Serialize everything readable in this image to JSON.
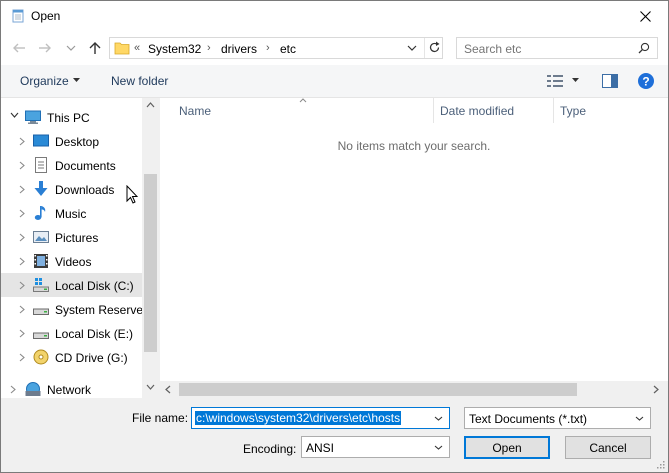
{
  "window": {
    "title": "Open",
    "icons": {
      "app": "notepad-icon",
      "close": "close-icon"
    }
  },
  "navigation": {
    "back": "back-arrow-icon",
    "forward": "forward-arrow-icon",
    "recent": "chevron-down-icon",
    "up": "up-arrow-icon"
  },
  "address_bar": {
    "overflow": "«",
    "segments": [
      "System32",
      "drivers",
      "etc"
    ],
    "refresh_icon": "refresh-icon"
  },
  "search": {
    "placeholder": "Search etc",
    "icon": "search-icon"
  },
  "toolbar": {
    "organize_label": "Organize",
    "new_folder_label": "New folder",
    "view_icon": "details-view-icon",
    "preview_icon": "preview-pane-icon",
    "help_icon": "help-icon"
  },
  "nav_tree": {
    "items": [
      {
        "label": "This PC",
        "icon": "computer-icon",
        "level": 0
      },
      {
        "label": "Desktop",
        "icon": "desktop-icon",
        "level": 1
      },
      {
        "label": "Documents",
        "icon": "documents-icon",
        "level": 1
      },
      {
        "label": "Downloads",
        "icon": "download-icon",
        "level": 1
      },
      {
        "label": "Music",
        "icon": "music-icon",
        "level": 1
      },
      {
        "label": "Pictures",
        "icon": "pictures-icon",
        "level": 1
      },
      {
        "label": "Videos",
        "icon": "videos-icon",
        "level": 1
      },
      {
        "label": "Local Disk (C:)",
        "icon": "windows-drive-icon",
        "level": 1,
        "selected": true
      },
      {
        "label": "System Reserved",
        "icon": "drive-icon",
        "level": 1
      },
      {
        "label": "Local Disk (E:)",
        "icon": "drive-icon",
        "level": 1
      },
      {
        "label": "CD Drive (G:)",
        "icon": "cd-drive-icon",
        "level": 1
      },
      {
        "label": "Network",
        "icon": "network-icon",
        "level": 0
      }
    ]
  },
  "file_list": {
    "columns": [
      "Name",
      "Date modified",
      "Type"
    ],
    "empty_message": "No items match your search."
  },
  "footer": {
    "file_name_label": "File name:",
    "file_name_value": "c:\\windows\\system32\\drivers\\etc\\hosts",
    "file_type_value": "Text Documents (*.txt)",
    "encoding_label": "Encoding:",
    "encoding_value": "ANSI",
    "open_label": "Open",
    "cancel_label": "Cancel"
  },
  "colors": {
    "accent": "#0078d7",
    "selection_bg": "#e5e5e5",
    "window_bg": "#f0f0f0",
    "link_text": "#1e395b",
    "muted_text": "#6d6d6d"
  }
}
